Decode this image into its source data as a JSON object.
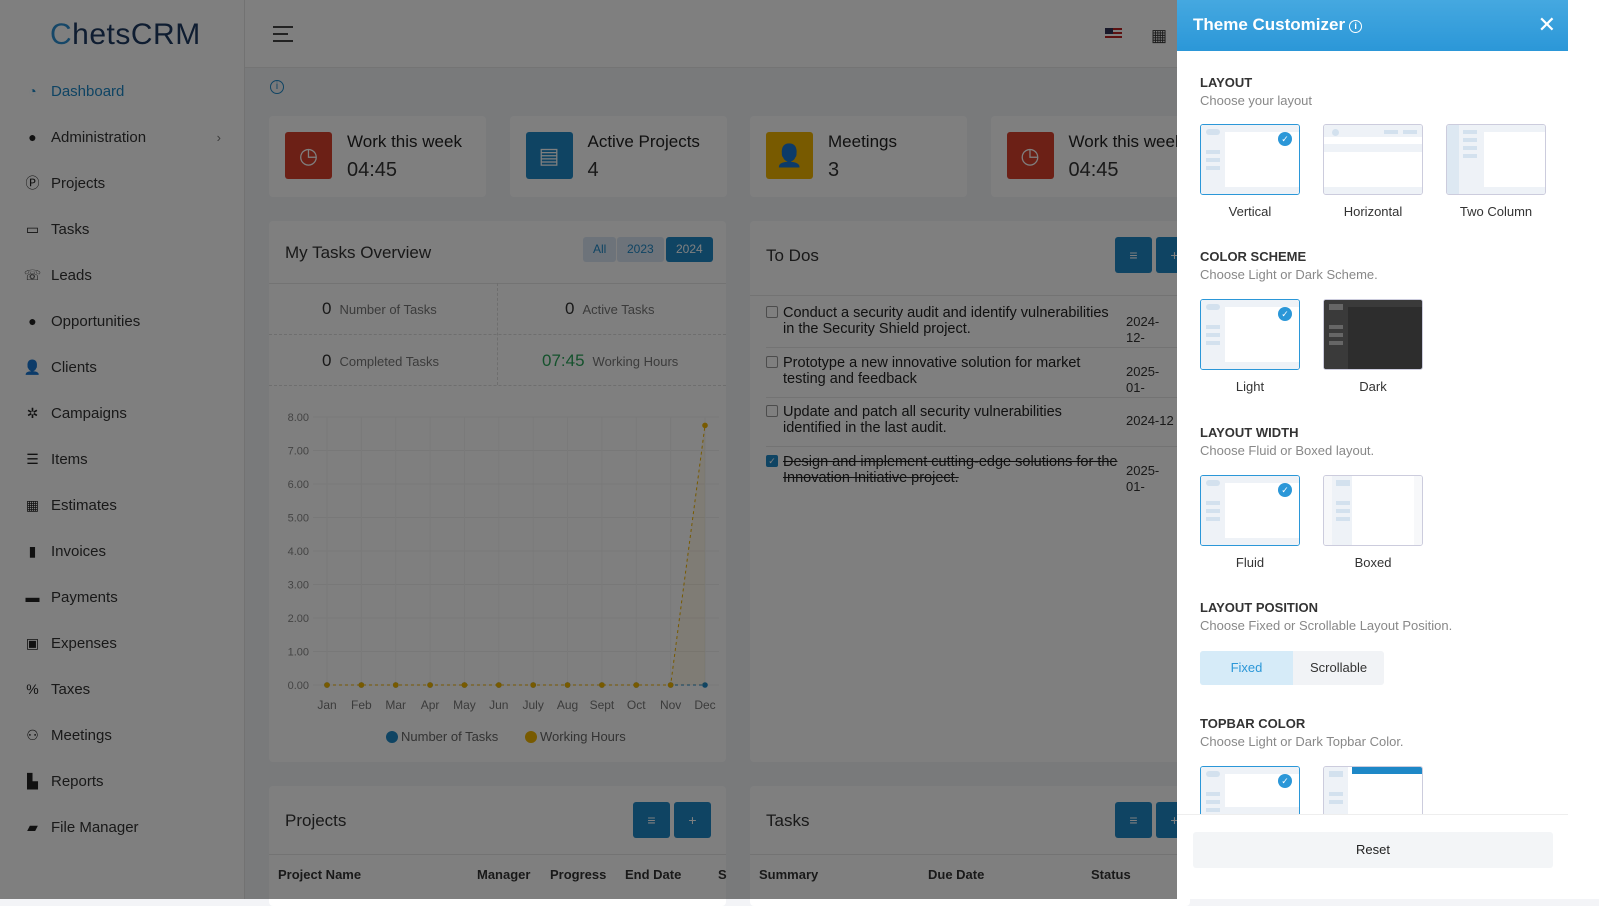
{
  "app": {
    "logo_text": "ChetsCRM"
  },
  "sidebar": {
    "items": [
      {
        "label": "Dashboard",
        "icon": "gauge-icon",
        "active": true
      },
      {
        "label": "Administration",
        "icon": "user-circle-icon",
        "has_children": true
      },
      {
        "label": "Projects",
        "icon": "p-circle-icon"
      },
      {
        "label": "Tasks",
        "icon": "ticket-icon"
      },
      {
        "label": "Leads",
        "icon": "phone-icon"
      },
      {
        "label": "Opportunities",
        "icon": "lightbulb-icon"
      },
      {
        "label": "Clients",
        "icon": "users-icon"
      },
      {
        "label": "Campaigns",
        "icon": "network-icon"
      },
      {
        "label": "Items",
        "icon": "list-icon"
      },
      {
        "label": "Estimates",
        "icon": "calculator-icon"
      },
      {
        "label": "Invoices",
        "icon": "file-icon"
      },
      {
        "label": "Payments",
        "icon": "credit-card-icon"
      },
      {
        "label": "Expenses",
        "icon": "receipt-icon"
      },
      {
        "label": "Taxes",
        "icon": "percent-icon"
      },
      {
        "label": "Meetings",
        "icon": "people-icon"
      },
      {
        "label": "Reports",
        "icon": "chart-icon"
      },
      {
        "label": "File Manager",
        "icon": "folder-icon"
      }
    ]
  },
  "stats": [
    {
      "title": "Work this week",
      "value": "04:45",
      "color": "#d9402c",
      "icon": "clock-icon"
    },
    {
      "title": "Active Projects",
      "value": "4",
      "color": "#1e88c7",
      "icon": "briefcase-icon"
    },
    {
      "title": "Meetings",
      "value": "3",
      "color": "#f0b400",
      "icon": "users-icon"
    },
    {
      "title": "Work this week",
      "value": "04:45",
      "color": "#d9402c",
      "icon": "clock-icon"
    }
  ],
  "overview": {
    "title": "My Tasks Overview",
    "filters": [
      "All",
      "2023",
      "2024"
    ],
    "active_filter": "2024",
    "number_of_tasks": {
      "value": "0",
      "label": "Number of Tasks"
    },
    "active_tasks": {
      "value": "0",
      "label": "Active Tasks"
    },
    "completed_tasks": {
      "value": "0",
      "label": "Completed Tasks"
    },
    "working_hours": {
      "value": "07:45",
      "label": "Working Hours"
    }
  },
  "chart_data": {
    "type": "line",
    "categories": [
      "Jan",
      "Feb",
      "Mar",
      "Apr",
      "May",
      "Jun",
      "July",
      "Aug",
      "Sept",
      "Oct",
      "Nov",
      "Dec"
    ],
    "yticks": [
      "0.00",
      "1.00",
      "2.00",
      "3.00",
      "4.00",
      "5.00",
      "6.00",
      "7.00",
      "8.00"
    ],
    "ylim": [
      0,
      8
    ],
    "legend_position": "bottom",
    "series": [
      {
        "name": "Number of Tasks",
        "color": "#1e88c7",
        "values": [
          0,
          0,
          0,
          0,
          0,
          0,
          0,
          0,
          0,
          0,
          0,
          0
        ]
      },
      {
        "name": "Working Hours",
        "color": "#f0b400",
        "values": [
          0,
          0,
          0,
          0,
          0,
          0,
          0,
          0,
          0,
          0,
          0,
          7.75
        ]
      }
    ]
  },
  "todos": {
    "title": "To Dos",
    "items": [
      {
        "text": "Conduct a security audit and identify vulnerabilities in the Security Shield project.",
        "date": "2024-12-",
        "done": false
      },
      {
        "text": "Prototype a new innovative solution for market testing and feedback",
        "date": "2025-01-",
        "done": false
      },
      {
        "text": "Update and patch all security vulnerabilities identified in the last audit.",
        "date": "2024-12",
        "done": false
      },
      {
        "text": "Design and implement cutting-edge solutions for the Innovation Initiative project.",
        "date": "2025-01-",
        "done": true
      }
    ]
  },
  "projects": {
    "title": "Projects",
    "columns": [
      "Project Name",
      "Manager",
      "Progress",
      "End Date",
      "S"
    ]
  },
  "tasks": {
    "title": "Tasks",
    "columns": [
      "Summary",
      "Due Date",
      "Status"
    ]
  },
  "customizer": {
    "title": "Theme Customizer",
    "layout": {
      "heading": "LAYOUT",
      "desc": "Choose your layout",
      "options": [
        "Vertical",
        "Horizontal",
        "Two Column"
      ],
      "selected": "Vertical"
    },
    "color_scheme": {
      "heading": "COLOR SCHEME",
      "desc": "Choose Light or Dark Scheme.",
      "options": [
        "Light",
        "Dark"
      ],
      "selected": "Light"
    },
    "layout_width": {
      "heading": "LAYOUT WIDTH",
      "desc": "Choose Fluid or Boxed layout.",
      "options": [
        "Fluid",
        "Boxed"
      ],
      "selected": "Fluid"
    },
    "layout_position": {
      "heading": "LAYOUT POSITION",
      "desc": "Choose Fixed or Scrollable Layout Position.",
      "options": [
        "Fixed",
        "Scrollable"
      ],
      "selected": "Fixed"
    },
    "topbar_color": {
      "heading": "TOPBAR COLOR",
      "desc": "Choose Light or Dark Topbar Color.",
      "selected": "Light"
    },
    "reset_label": "Reset"
  }
}
